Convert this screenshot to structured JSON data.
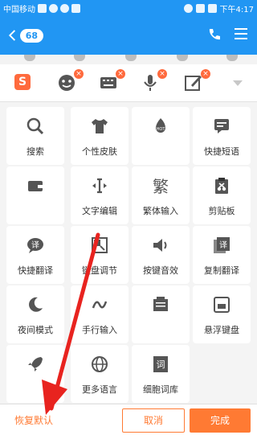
{
  "status_bar": {
    "carrier": "中国移动",
    "time": "下午4:17"
  },
  "header": {
    "unread_count": "68",
    "title": ""
  },
  "toolbar": {
    "logo": "S",
    "close_mark": "×"
  },
  "grid": {
    "items": [
      {
        "label": "搜索",
        "icon": "search-icon"
      },
      {
        "label": "个性皮肤",
        "icon": "shirt-icon"
      },
      {
        "label": "",
        "icon": "hot-icon"
      },
      {
        "label": "快捷短语",
        "icon": "message-icon"
      },
      {
        "label": "",
        "icon": "wallet-icon"
      },
      {
        "label": "文字编辑",
        "icon": "text-cursor-icon"
      },
      {
        "label": "繁体输入",
        "icon": "traditional-char-icon",
        "glyph": "繁"
      },
      {
        "label": "剪贴板",
        "icon": "clipboard-icon"
      },
      {
        "label": "快捷翻译",
        "icon": "translate-bubble-icon",
        "glyph": "译"
      },
      {
        "label": "键盘调节",
        "icon": "resize-icon"
      },
      {
        "label": "按键音效",
        "icon": "speaker-icon"
      },
      {
        "label": "复制翻译",
        "icon": "copy-translate-icon",
        "glyph": "译"
      },
      {
        "label": "夜间模式",
        "icon": "moon-icon"
      },
      {
        "label": "手行输入",
        "icon": "handwrite-icon"
      },
      {
        "label": "",
        "icon": "phrase-icon"
      },
      {
        "label": "悬浮键盘",
        "icon": "floating-keyboard-icon"
      },
      {
        "label": "",
        "icon": "rocket-icon"
      },
      {
        "label": "更多语言",
        "icon": "globe-icon"
      },
      {
        "label": "细胞词库",
        "icon": "dictionary-icon",
        "glyph": "词"
      }
    ]
  },
  "footer": {
    "restore_label": "恢复默认",
    "cancel_label": "取消",
    "done_label": "完成"
  },
  "colors": {
    "accent": "#ff7a33",
    "header_blue": "#2196f3",
    "arrow_red": "#e8231f"
  }
}
